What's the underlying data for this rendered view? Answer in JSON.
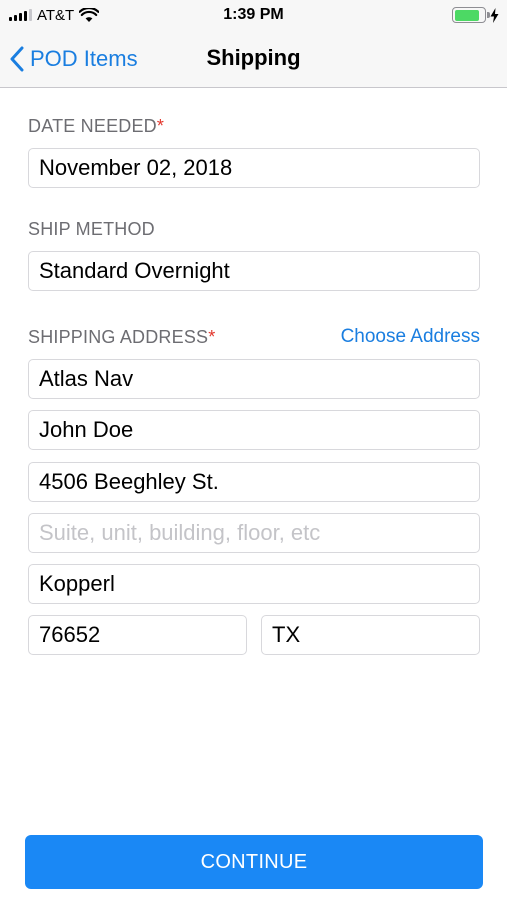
{
  "status_bar": {
    "carrier": "AT&T",
    "time": "1:39 PM",
    "battery_level": 0.85
  },
  "nav": {
    "back_label": "POD Items",
    "title": "Shipping"
  },
  "form": {
    "date_needed": {
      "label": "DATE NEEDED",
      "required_mark": "*",
      "value": "November 02, 2018"
    },
    "ship_method": {
      "label": "SHIP METHOD",
      "value": "Standard Overnight"
    },
    "shipping_address": {
      "label": "SHIPPING ADDRESS",
      "required_mark": "*",
      "choose_link": "Choose Address",
      "company": "Atlas Nav",
      "name": "John Doe",
      "street": "4506 Beeghley St.",
      "suite_placeholder": "Suite, unit, building, floor, etc",
      "city": "Kopperl",
      "zip": "76652",
      "state": "TX"
    }
  },
  "continue_label": "CONTINUE",
  "colors": {
    "accent": "#1a7ee0",
    "button": "#1a88f5",
    "required": "#e2352b",
    "battery": "#4cd964"
  }
}
